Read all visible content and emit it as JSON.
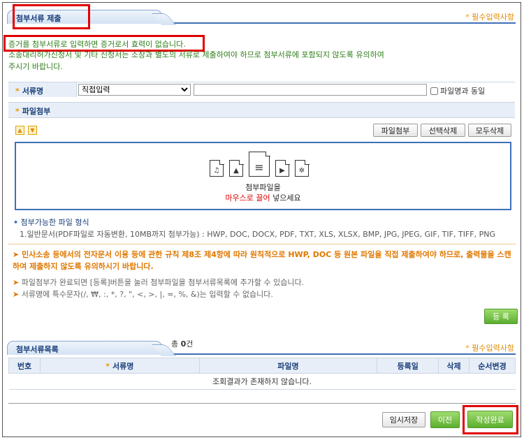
{
  "attach_section": {
    "title": "첨부서류 제출",
    "required_note": "필수입력사항"
  },
  "notice": {
    "line1": "증거를 첨부서류로 입력하면 증거로서 효력이 없습니다.",
    "line2": "소송대리허가신청서 및 기타 신청서는 소장과 별도의 서류로 제출하여야 하므로 첨부서류에 포함되지 않도록 유의하여",
    "line3": "주시기 바랍니다."
  },
  "form": {
    "doc_name_label": "서류명",
    "doc_select_value": "직접입력",
    "doc_name_input_value": "",
    "same_as_filename_label": "파일명과 동일",
    "attach_label": "파일첨부"
  },
  "file_buttons": {
    "attach": "파일첨부",
    "delete_selected": "선택삭제",
    "delete_all": "모두삭제"
  },
  "dropzone": {
    "line1": "첨부파일을",
    "line2_red": "마우스로 끌어",
    "line2_rest": "넣으세요",
    "icons": [
      "music-file-icon",
      "image-file-icon",
      "document-file-icon",
      "video-file-icon",
      "settings-file-icon"
    ]
  },
  "formats": {
    "title": "첨부가능한 파일 형식",
    "line1": "1.일반문서(PDF파일로 자동변환, 10MB까지 첨부가능) : HWP, DOC, DOCX, PDF, TXT, XLS, XLSX, BMP, JPG, JPEG, GIF, TIF, TIFF, PNG"
  },
  "warnings": {
    "main": "민사소송 등에서의 전자문서 이용 등에 관한 규칙 제8조 제4항에 따라 원칙적으로 HWP, DOC 등 원본 파일을 직접 제출하여야 하므로, 출력물을 스캔하여 제출하지 않도록 유의하시기 바랍니다.",
    "tip1": "파일첨부가 완료되면 [등록]버튼을 눌러 첨부파일을 첨부서류목록에 추가할 수 있습니다.",
    "tip2": "서류명에 특수문자(/, ₩, :, *, ?, \", <, >, |, =, %, &)는 입력할 수 없습니다."
  },
  "register_button": "등 록",
  "list_section": {
    "title": "첨부서류목록",
    "count_prefix": "총",
    "count": "0",
    "count_suffix": "건",
    "required_note": "필수입력사항",
    "columns": {
      "no": "번호",
      "doc_name": "서류명",
      "file_name": "파일명",
      "reg_date": "등록일",
      "delete": "삭제",
      "order": "순서변경"
    },
    "empty_message": "조회결과가 존재하지 않습니다."
  },
  "footer_buttons": {
    "temp_save": "임시저장",
    "prev": "이전",
    "complete": "작성완료"
  },
  "colors": {
    "accent_blue": "#3f6fb6",
    "notice_green": "#2e7d1a",
    "warning_orange": "#e07800",
    "highlight_red": "#e00000",
    "button_green": "#5cae2f"
  }
}
